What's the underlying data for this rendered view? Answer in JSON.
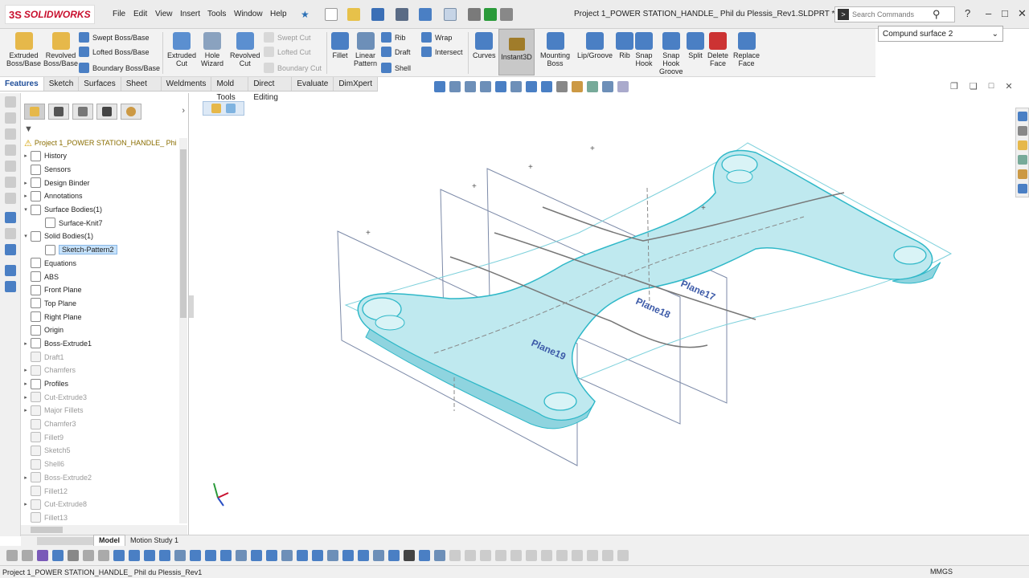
{
  "app": {
    "logo_ds": "3S",
    "logo_name": "SOLIDWORKS"
  },
  "menu": [
    "File",
    "Edit",
    "View",
    "Insert",
    "Tools",
    "Window",
    "Help"
  ],
  "document_title": "Project 1_POWER STATION_HANDLE_ Phil du Plessis_Rev1.SLDPRT *",
  "search": {
    "placeholder": "Search Commands"
  },
  "ribbon": {
    "extruded_boss": "Extruded\nBoss/Base",
    "revolved_boss": "Revolved\nBoss/Base",
    "swept_boss": "Swept Boss/Base",
    "lofted_boss": "Lofted Boss/Base",
    "boundary_boss": "Boundary Boss/Base",
    "extruded_cut": "Extruded\nCut",
    "hole_wizard": "Hole\nWizard",
    "revolved_cut": "Revolved\nCut",
    "swept_cut": "Swept Cut",
    "lofted_cut": "Lofted Cut",
    "boundary_cut": "Boundary Cut",
    "fillet": "Fillet",
    "linear_pattern": "Linear\nPattern",
    "rib": "Rib",
    "draft": "Draft",
    "shell": "Shell",
    "wrap": "Wrap",
    "intersect": "Intersect",
    "curves": "Curves",
    "instant3d": "Instant3D",
    "mounting_boss": "Mounting\nBoss",
    "lip_groove": "Lip/Groove",
    "rib2": "Rib",
    "snap_hook": "Snap\nHook",
    "snap_hook_groove": "Snap\nHook\nGroove",
    "split": "Split",
    "delete_face": "Delete\nFace",
    "replace_face": "Replace\nFace"
  },
  "compound_select": {
    "value": "Compund surface 2"
  },
  "tabs": [
    "Features",
    "Sketch",
    "Surfaces",
    "Sheet Metal",
    "Weldments",
    "Mold Tools",
    "Direct Editing",
    "Evaluate",
    "DimXpert"
  ],
  "feature_tree": {
    "root": "Project 1_POWER STATION_HANDLE_ Phi",
    "items": [
      {
        "label": "History"
      },
      {
        "label": "Sensors"
      },
      {
        "label": "Design Binder"
      },
      {
        "label": "Annotations"
      },
      {
        "label": "Surface Bodies(1)"
      },
      {
        "label": "Surface-Knit7"
      },
      {
        "label": "Solid Bodies(1)"
      },
      {
        "label": "Sketch-Pattern2"
      },
      {
        "label": "Equations"
      },
      {
        "label": "ABS"
      },
      {
        "label": "Front Plane"
      },
      {
        "label": "Top Plane"
      },
      {
        "label": "Right Plane"
      },
      {
        "label": "Origin"
      },
      {
        "label": "Boss-Extrude1"
      },
      {
        "label": "Draft1"
      },
      {
        "label": "Chamfers"
      },
      {
        "label": "Profiles"
      },
      {
        "label": "Cut-Extrude3"
      },
      {
        "label": "Major Fillets"
      },
      {
        "label": "Chamfer3"
      },
      {
        "label": "Fillet9"
      },
      {
        "label": "Sketch5"
      },
      {
        "label": "Shell6"
      },
      {
        "label": "Boss-Extrude2"
      },
      {
        "label": "Fillet12"
      },
      {
        "label": "Cut-Extrude8"
      },
      {
        "label": "Fillet13"
      }
    ]
  },
  "plane_labels": [
    "Plane17",
    "Plane18",
    "Plane19"
  ],
  "bottom_tabs": {
    "model": "Model",
    "motion": "Motion Study 1"
  },
  "status": {
    "text": "Project 1_POWER STATION_HANDLE_ Phil du Plessis_Rev1",
    "units": "MMGS"
  },
  "colors": {
    "model_cyan": "#2fb8c8",
    "surface_fill": "#bfe9ef",
    "brand_red": "#c8102e",
    "selection_blue": "#c6e2fb"
  }
}
